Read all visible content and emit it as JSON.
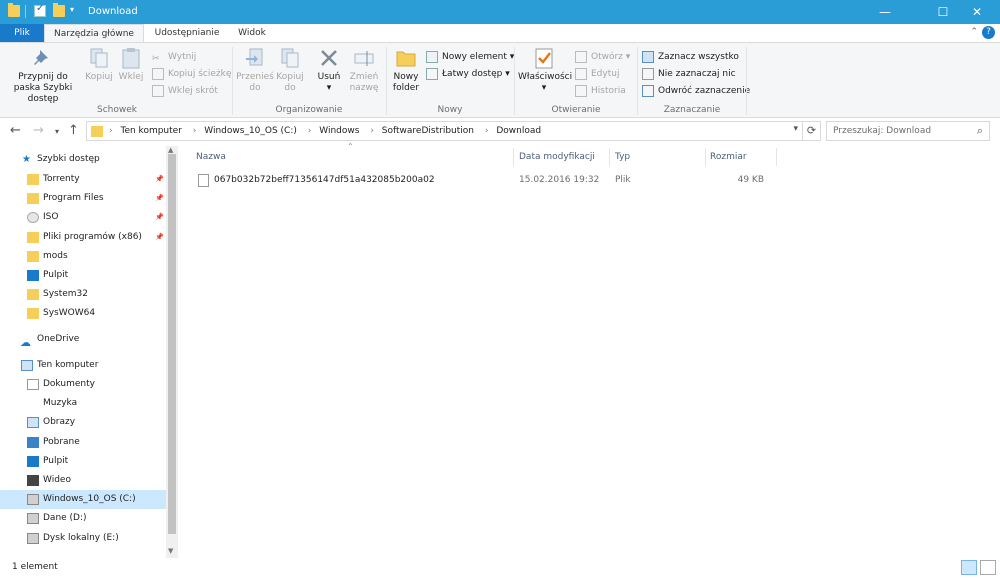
{
  "window": {
    "title": "Download"
  },
  "tabs": {
    "file": "Plik",
    "home": "Narzędzia główne",
    "share": "Udostępnianie",
    "view": "Widok"
  },
  "ribbon": {
    "clipboard": {
      "label": "Schowek",
      "pin": "Przypnij do paska Szybki dostęp",
      "copy": "Kopiuj",
      "paste": "Wklej",
      "cut": "Wytnij",
      "copy_path": "Kopiuj ścieżkę",
      "paste_shortcut": "Wklej skrót"
    },
    "organize": {
      "label": "Organizowanie",
      "move_to": "Przenieś do",
      "copy_to": "Kopiuj do",
      "delete": "Usuń",
      "rename": "Zmień nazwę"
    },
    "new": {
      "label": "Nowy",
      "new_folder": "Nowy folder",
      "new_item": "Nowy element",
      "easy_access": "Łatwy dostęp"
    },
    "open": {
      "label": "Otwieranie",
      "properties": "Właściwości",
      "open": "Otwórz",
      "edit": "Edytuj",
      "history": "Historia"
    },
    "select": {
      "label": "Zaznaczanie",
      "select_all": "Zaznacz wszystko",
      "select_none": "Nie zaznaczaj nic",
      "invert": "Odwróć zaznaczenie"
    }
  },
  "address": {
    "crumbs": [
      "Ten komputer",
      "Windows_10_OS (C:)",
      "Windows",
      "SoftwareDistribution",
      "Download"
    ],
    "search_placeholder": "Przeszukaj: Download"
  },
  "nav": {
    "quick_access": "Szybki dostęp",
    "quick_items": [
      {
        "label": "Torrenty",
        "pinned": true
      },
      {
        "label": "Program Files",
        "pinned": true
      },
      {
        "label": "ISO",
        "pinned": true
      },
      {
        "label": "Pliki programów (x86)",
        "pinned": true
      },
      {
        "label": "mods",
        "pinned": false
      },
      {
        "label": "Pulpit",
        "pinned": false
      },
      {
        "label": "System32",
        "pinned": false
      },
      {
        "label": "SysWOW64",
        "pinned": false
      }
    ],
    "onedrive": "OneDrive",
    "this_pc": "Ten komputer",
    "pc_items": [
      {
        "label": "Dokumenty"
      },
      {
        "label": "Muzyka"
      },
      {
        "label": "Obrazy"
      },
      {
        "label": "Pobrane"
      },
      {
        "label": "Pulpit"
      },
      {
        "label": "Wideo"
      },
      {
        "label": "Windows_10_OS (C:)",
        "selected": true
      },
      {
        "label": "Dane (D:)"
      },
      {
        "label": "Dysk lokalny (E:)"
      }
    ]
  },
  "columns": {
    "name": "Nazwa",
    "date": "Data modyfikacji",
    "type": "Typ",
    "size": "Rozmiar"
  },
  "files": [
    {
      "name": "067b032b72beff71356147df51a432085b200a02",
      "date": "15.02.2016 19:32",
      "type": "Plik",
      "size": "49 KB"
    }
  ],
  "status": {
    "count": "1 element"
  },
  "colors": {
    "titlebar": "#2b9dd6",
    "file_tab": "#1979ca",
    "selection": "#cce8ff",
    "folder": "#f5cf5a"
  }
}
